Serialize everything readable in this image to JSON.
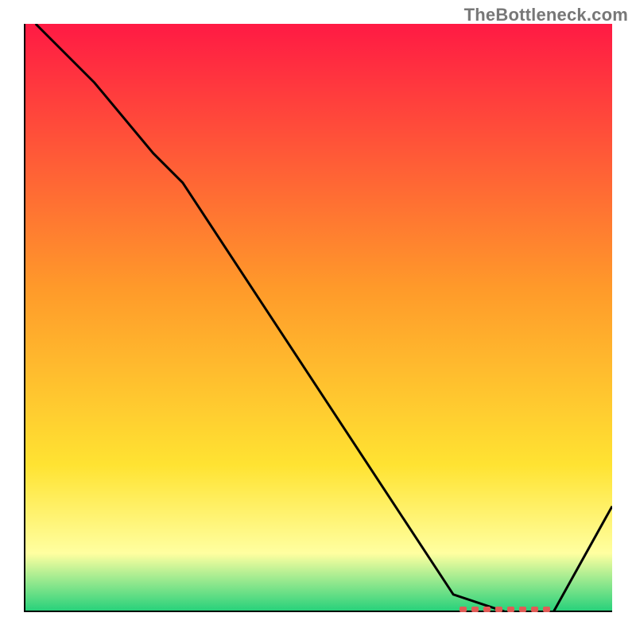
{
  "watermark_text": "TheBottleneck.com",
  "colors": {
    "gradient_top": "#ff1a44",
    "gradient_upper_mid": "#ff9a2a",
    "gradient_mid": "#ffe332",
    "gradient_low_band": "#ffffa0",
    "gradient_bottom": "#22d07a",
    "curve": "#000000",
    "dash": "#e15b56",
    "axis": "#000000",
    "watermark": "#777777"
  },
  "chart_data": {
    "type": "line",
    "title": "",
    "xlabel": "",
    "ylabel": "",
    "xlim": [
      0,
      100
    ],
    "ylim": [
      0,
      100
    ],
    "series": [
      {
        "name": "curve",
        "x": [
          2,
          12,
          22,
          27,
          73,
          82,
          90,
          100
        ],
        "values": [
          100,
          90,
          78,
          73,
          3,
          0,
          0,
          18
        ]
      }
    ],
    "highlight_band": {
      "x_start": 74,
      "x_end": 90,
      "y": 0.5
    },
    "background_gradient_stops": [
      {
        "offset": 0.0,
        "color": "#ff1a44"
      },
      {
        "offset": 0.45,
        "color": "#ff9a2a"
      },
      {
        "offset": 0.75,
        "color": "#ffe332"
      },
      {
        "offset": 0.9,
        "color": "#ffffa0"
      },
      {
        "offset": 1.0,
        "color": "#22d07a"
      }
    ]
  }
}
